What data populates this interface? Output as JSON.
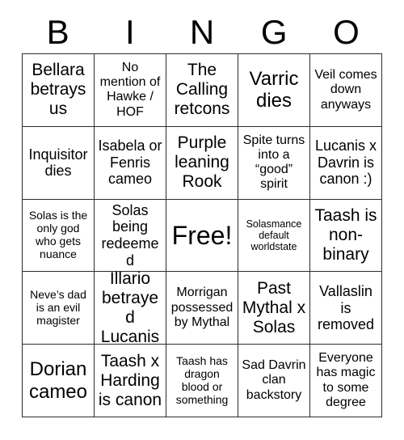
{
  "card": {
    "header_letters": [
      "B",
      "I",
      "N",
      "G",
      "O"
    ],
    "free_space_label": "Free!",
    "rows": [
      [
        {
          "text": "Bellara betrays us",
          "size": "l"
        },
        {
          "text": "No mention of Hawke / HOF",
          "size": "s"
        },
        {
          "text": "The Calling retcons",
          "size": "l"
        },
        {
          "text": "Varric dies",
          "size": "xl"
        },
        {
          "text": "Veil comes down anyways",
          "size": "s"
        }
      ],
      [
        {
          "text": "Inquisitor dies",
          "size": "m"
        },
        {
          "text": "Isabela or Fenris cameo",
          "size": "m"
        },
        {
          "text": "Purple leaning Rook",
          "size": "l"
        },
        {
          "text": "Spite turns into a “good” spirit",
          "size": "s"
        },
        {
          "text": "Lucanis x Davrin is canon :)",
          "size": "m"
        }
      ],
      [
        {
          "text": "Solas is the only god who gets nuance",
          "size": "xs"
        },
        {
          "text": "Solas being redeemed",
          "size": "m"
        },
        {
          "text": "Free!",
          "size": "free"
        },
        {
          "text": "Solasmance default worldstate",
          "size": "xxs"
        },
        {
          "text": "Taash is non-binary",
          "size": "l"
        }
      ],
      [
        {
          "text": "Neve’s dad is an evil magister",
          "size": "xs"
        },
        {
          "text": "Illario betrayed Lucanis",
          "size": "l"
        },
        {
          "text": "Morrigan possessed by Mythal",
          "size": "s"
        },
        {
          "text": "Past Mythal x Solas",
          "size": "l"
        },
        {
          "text": "Vallaslin is removed",
          "size": "m"
        }
      ],
      [
        {
          "text": "Dorian cameo",
          "size": "xl"
        },
        {
          "text": "Taash x Harding is canon",
          "size": "l"
        },
        {
          "text": "Taash has dragon blood or something",
          "size": "xs"
        },
        {
          "text": "Sad Davrin clan backstory",
          "size": "s"
        },
        {
          "text": "Everyone has magic to some degree",
          "size": "s"
        }
      ]
    ]
  },
  "colors": {
    "background": "#ffffff",
    "text": "#000000",
    "grid_line": "#2b2b2b"
  }
}
